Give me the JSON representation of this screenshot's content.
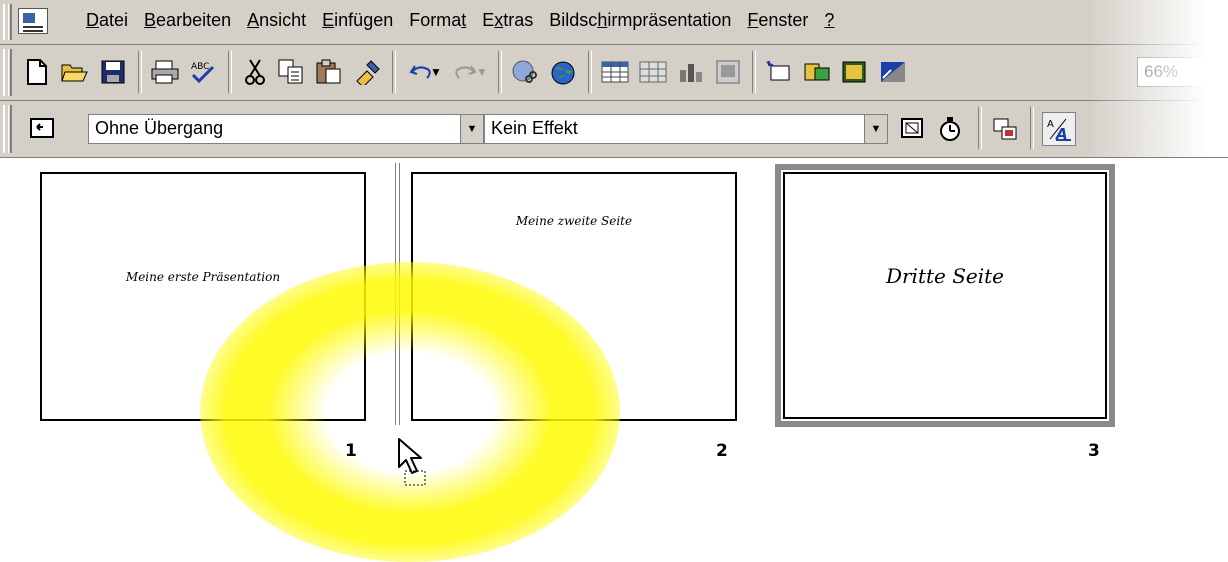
{
  "menubar": {
    "items": [
      "Datei",
      "Bearbeiten",
      "Ansicht",
      "Einfügen",
      "Format",
      "Extras",
      "Bildschirmpräsentation",
      "Fenster",
      "?"
    ],
    "underline": [
      "D",
      "B",
      "A",
      "E",
      "t",
      "x",
      "c",
      "F",
      "?"
    ],
    "underline_index": [
      0,
      0,
      0,
      0,
      5,
      1,
      6,
      0,
      0
    ]
  },
  "toolbar_standard": {
    "zoom": "66%",
    "icons": [
      "new-document-icon",
      "open-folder-icon",
      "save-icon",
      "print-icon",
      "spelling-icon",
      "cut-icon",
      "copy-icon",
      "paste-icon",
      "format-painter-icon",
      "undo-icon",
      "undo-dropdown-icon",
      "redo-icon",
      "redo-dropdown-icon",
      "insert-hyperlink-icon",
      "web-toolbar-icon",
      "insert-table-icon",
      "tables-borders-icon",
      "insert-chart-icon",
      "new-slide-icon",
      "expand-icon",
      "show-formatting-icon",
      "grayscale-icon"
    ]
  },
  "toolbar_sorter": {
    "transition": "Ohne Übergang",
    "effect": "Kein Effekt"
  },
  "slides": [
    {
      "text": "Meine erste Präsentation",
      "number": "1"
    },
    {
      "text": "Meine zweite Seite",
      "number": "2"
    },
    {
      "text": "Dritte Seite",
      "number": "3"
    }
  ],
  "colors": {
    "toolbar": "#d4d0c8",
    "highlight": "#fff200",
    "selected_border": "#808080"
  }
}
